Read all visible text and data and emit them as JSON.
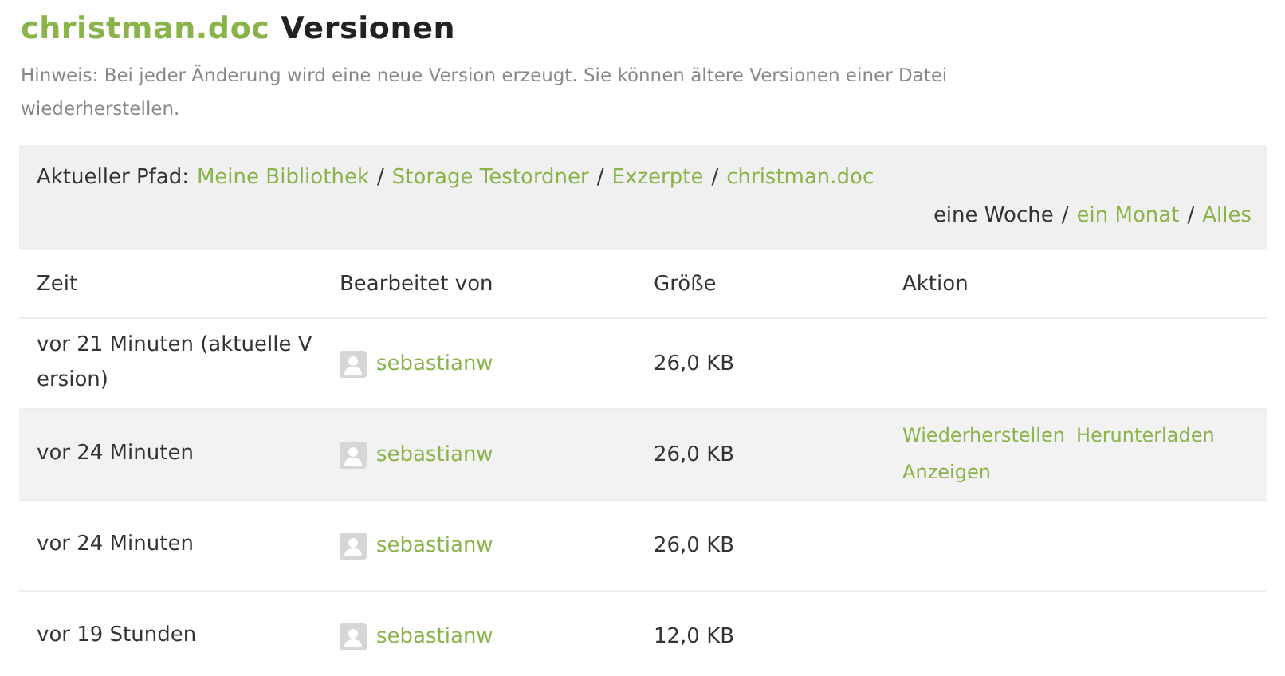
{
  "title": {
    "filename": "christman.doc",
    "suffix": "Versionen"
  },
  "hint": "Hinweis: Bei jeder Änderung wird eine neue Version erzeugt. Sie können ältere Versionen einer Datei wiederherstellen.",
  "path": {
    "label": "Aktueller Pfad:",
    "crumbs": [
      "Meine Bibliothek",
      "Storage Testordner",
      "Exzerpte",
      "christman.doc"
    ],
    "separator": "/"
  },
  "periods": [
    {
      "label": "eine Woche",
      "selected": true
    },
    {
      "label": "ein Monat",
      "selected": false
    },
    {
      "label": "Alles",
      "selected": false
    }
  ],
  "table": {
    "columns": [
      "Zeit",
      "Bearbeitet von",
      "Größe",
      "Aktion"
    ],
    "rows": [
      {
        "time": "vor 21 Minuten (aktuelle Version)",
        "user": "sebastianw",
        "size": "26,0 KB",
        "hovered": false,
        "actions": []
      },
      {
        "time": "vor 24 Minuten",
        "user": "sebastianw",
        "size": "26,0 KB",
        "hovered": true,
        "actions": [
          "Wiederherstellen",
          "Herunterladen",
          "Anzeigen"
        ]
      },
      {
        "time": "vor 24 Minuten",
        "user": "sebastianw",
        "size": "26,0 KB",
        "hovered": false,
        "actions": []
      },
      {
        "time": "vor 19 Stunden",
        "user": "sebastianw",
        "size": "12,0 KB",
        "hovered": false,
        "actions": []
      }
    ]
  }
}
